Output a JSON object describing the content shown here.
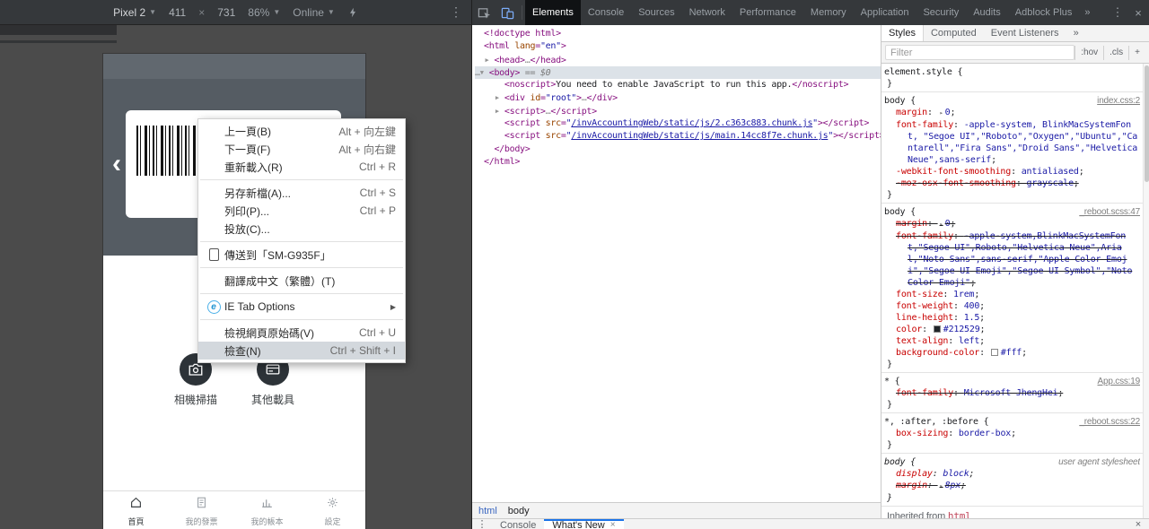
{
  "device_toolbar": {
    "device": "Pixel 2",
    "width": "411",
    "height": "731",
    "zoom": "86%",
    "network": "Online"
  },
  "devtools": {
    "tabs": [
      "Elements",
      "Console",
      "Sources",
      "Network",
      "Performance",
      "Memory",
      "Application",
      "Security",
      "Audits",
      "Adblock Plus"
    ],
    "active_tab": "Elements",
    "overflow_chevron": "»"
  },
  "app": {
    "back_chevron": "‹",
    "actions": [
      {
        "icon": "camera-icon",
        "label": "相機掃描"
      },
      {
        "icon": "card-icon",
        "label": "其他載具"
      }
    ],
    "nav": [
      {
        "icon": "home-icon",
        "label": "首頁",
        "active": true
      },
      {
        "icon": "receipt-icon",
        "label": "我的發票"
      },
      {
        "icon": "chart-icon",
        "label": "我的帳本"
      },
      {
        "icon": "gear-icon",
        "label": "設定"
      }
    ]
  },
  "context_menu": {
    "items": [
      {
        "label": "上一頁(B)",
        "shortcut": "Alt + 向左鍵"
      },
      {
        "label": "下一頁(F)",
        "shortcut": "Alt + 向右鍵"
      },
      {
        "label": "重新載入(R)",
        "shortcut": "Ctrl + R"
      },
      {
        "separator": true
      },
      {
        "label": "另存新檔(A)...",
        "shortcut": "Ctrl + S"
      },
      {
        "label": "列印(P)...",
        "shortcut": "Ctrl + P"
      },
      {
        "label": "投放(C)..."
      },
      {
        "separator": true
      },
      {
        "label": "傳送到「SM-G935F」",
        "icon": "device"
      },
      {
        "separator": true
      },
      {
        "label": "翻譯成中文（繁體）(T)"
      },
      {
        "separator": true
      },
      {
        "label": "IE Tab Options",
        "icon": "ie",
        "submenu": true
      },
      {
        "separator": true
      },
      {
        "label": "檢視網頁原始碼(V)",
        "shortcut": "Ctrl + U"
      },
      {
        "label": "檢查(N)",
        "shortcut": "Ctrl + Shift + I",
        "highlighted": true
      }
    ]
  },
  "elements_panel": {
    "lines": [
      {
        "indent": 0,
        "tokens": [
          {
            "c": "tag",
            "s": "<!doctype html>"
          }
        ]
      },
      {
        "indent": 0,
        "tokens": [
          {
            "c": "tag",
            "s": "<html"
          },
          {
            "c": "attr",
            "s": " lang"
          },
          {
            "c": "tag",
            "s": "="
          },
          {
            "c": "str",
            "s": "\"en\""
          },
          {
            "c": "tag",
            "s": ">"
          }
        ]
      },
      {
        "indent": 1,
        "arrow": "▶",
        "tokens": [
          {
            "c": "tag",
            "s": "<head>"
          },
          {
            "c": "meta",
            "s": "…"
          },
          {
            "c": "tag",
            "s": "</head>"
          }
        ]
      },
      {
        "indent": 1,
        "prefix": "…",
        "arrow": "▼",
        "selected": true,
        "tokens": [
          {
            "c": "tag",
            "s": "<body>"
          },
          {
            "c": "flag",
            "s": " == $0"
          }
        ]
      },
      {
        "indent": 2,
        "tokens": [
          {
            "c": "tag",
            "s": "<noscript>"
          },
          {
            "c": "txt",
            "s": "You need to enable JavaScript to run this app."
          },
          {
            "c": "tag",
            "s": "</noscript>"
          }
        ]
      },
      {
        "indent": 2,
        "arrow": "▶",
        "tokens": [
          {
            "c": "tag",
            "s": "<div"
          },
          {
            "c": "attr",
            "s": " id"
          },
          {
            "c": "tag",
            "s": "="
          },
          {
            "c": "str",
            "s": "\"root\""
          },
          {
            "c": "tag",
            "s": ">"
          },
          {
            "c": "meta",
            "s": "…"
          },
          {
            "c": "tag",
            "s": "</div>"
          }
        ]
      },
      {
        "indent": 2,
        "arrow": "▶",
        "tokens": [
          {
            "c": "tag",
            "s": "<script>"
          },
          {
            "c": "meta",
            "s": "…"
          },
          {
            "c": "tag",
            "s": "</script>"
          }
        ]
      },
      {
        "indent": 2,
        "tokens": [
          {
            "c": "tag",
            "s": "<script"
          },
          {
            "c": "attr",
            "s": " src"
          },
          {
            "c": "tag",
            "s": "="
          },
          {
            "c": "str",
            "s": "\""
          },
          {
            "c": "lnk",
            "s": "/invAccountingWeb/static/js/2.c363c883.chunk.js"
          },
          {
            "c": "str",
            "s": "\""
          },
          {
            "c": "tag",
            "s": "></script>"
          }
        ]
      },
      {
        "indent": 2,
        "tokens": [
          {
            "c": "tag",
            "s": "<script"
          },
          {
            "c": "attr",
            "s": " src"
          },
          {
            "c": "tag",
            "s": "="
          },
          {
            "c": "str",
            "s": "\""
          },
          {
            "c": "lnk",
            "s": "/invAccountingWeb/static/js/main.14cc8f7e.chunk.js"
          },
          {
            "c": "str",
            "s": "\""
          },
          {
            "c": "tag",
            "s": "></script>"
          }
        ]
      },
      {
        "indent": 1,
        "tokens": [
          {
            "c": "tag",
            "s": "</body>"
          }
        ]
      },
      {
        "indent": 0,
        "tokens": [
          {
            "c": "tag",
            "s": "</html>"
          }
        ]
      }
    ]
  },
  "breadcrumb": {
    "items": [
      "html",
      "body"
    ]
  },
  "styles_panel": {
    "tabs": [
      "Styles",
      "Computed",
      "Event Listeners"
    ],
    "active_tab": "Styles",
    "overflow_chevron": "»",
    "filter_placeholder": "Filter",
    "controls": [
      ":hov",
      ".cls",
      "+"
    ],
    "rules": [
      {
        "selector": "element.style",
        "props": []
      },
      {
        "selector": "body",
        "link": "index.css:2",
        "props": [
          {
            "name": "margin",
            "value": "0",
            "arrow": true
          },
          {
            "name": "font-family",
            "value": "-apple-system, BlinkMacSystemFont, \"Segoe UI\",\"Roboto\",\"Oxygen\",\"Ubuntu\",\"Cantarell\",\"Fira Sans\",\"Droid Sans\",\"Helvetica Neue\",sans-serif"
          },
          {
            "name": "-webkit-font-smoothing",
            "value": "antialiased"
          },
          {
            "name": "-moz-osx-font-smoothing",
            "value": "grayscale",
            "struck": true
          }
        ]
      },
      {
        "selector": "body",
        "link": "_reboot.scss:47",
        "props": [
          {
            "name": "margin",
            "value": "0",
            "arrow": true,
            "struck": true
          },
          {
            "name": "font-family",
            "value": "-apple-system,BlinkMacSystemFont,\"Segoe UI\",Roboto,\"Helvetica Neue\",Arial,\"Noto Sans\",sans-serif,\"Apple Color Emoji\",\"Segoe UI Emoji\",\"Segoe UI Symbol\",\"Noto Color Emoji\"",
            "struck": true
          },
          {
            "name": "font-size",
            "value": "1rem"
          },
          {
            "name": "font-weight",
            "value": "400"
          },
          {
            "name": "line-height",
            "value": "1.5"
          },
          {
            "name": "color",
            "value": "#212529",
            "swatch": "#212529"
          },
          {
            "name": "text-align",
            "value": "left"
          },
          {
            "name": "background-color",
            "value": "#fff",
            "swatch": "#ffffff"
          }
        ]
      },
      {
        "selector": "*",
        "link": "App.css:19",
        "props": [
          {
            "name": "font-family",
            "value": "Microsoft JhengHei",
            "struck": true
          }
        ]
      },
      {
        "selector": "*, :after, :before",
        "link": "_reboot.scss:22",
        "props": [
          {
            "name": "box-sizing",
            "value": "border-box"
          }
        ]
      },
      {
        "selector": "body",
        "link": "user agent stylesheet",
        "ua": true,
        "props": [
          {
            "name": "display",
            "value": "block"
          },
          {
            "name": "margin",
            "value": "8px",
            "arrow": true,
            "struck": true
          }
        ]
      }
    ],
    "inherited_label": "Inherited from",
    "inherited_node": "html"
  },
  "drawer": {
    "tabs": [
      {
        "label": "Console"
      },
      {
        "label": "What's New",
        "active": true,
        "closable": true
      }
    ]
  }
}
